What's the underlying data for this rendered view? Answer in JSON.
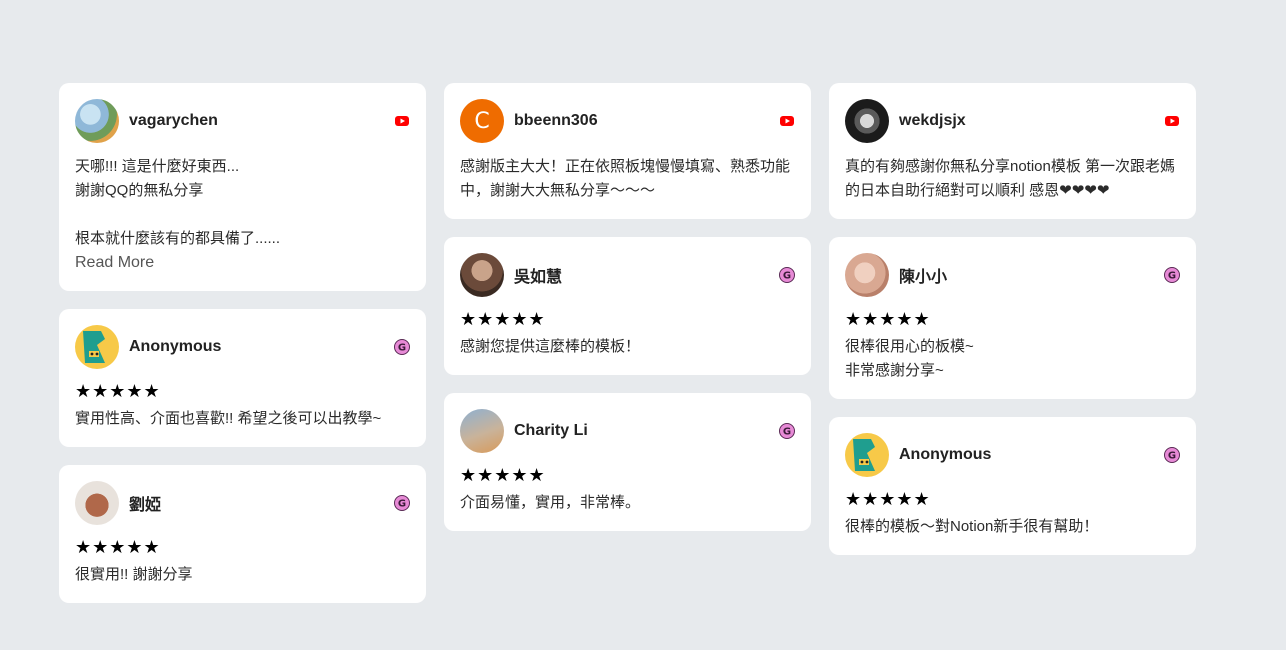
{
  "colors": {
    "background": "#e7eaed",
    "card": "#ffffff",
    "youtube_red": "#ff0000",
    "google_badge_pink": "#e78ad6"
  },
  "reviews": [
    {
      "name": "vagarychen",
      "source_icon": "youtube-icon",
      "stars": "",
      "text": "天哪!!! 這是什麼好東西...\n謝謝QQ的無私分享\n\n根本就什麼該有的都具備了......",
      "read_more": "Read More"
    },
    {
      "name": "Anonymous",
      "source_icon": "google-icon",
      "stars": "★★★★★",
      "rating": 5,
      "text": "實用性高、介面也喜歡!! 希望之後可以出教學~"
    },
    {
      "name": "劉婭",
      "source_icon": "google-icon",
      "stars": "★★★★★",
      "rating": 5,
      "text": "很實用!! 謝謝分享"
    },
    {
      "name": "bbeenn306",
      "avatar_initial": "C",
      "source_icon": "youtube-icon",
      "text": "感謝版主大大！正在依照板塊慢慢填寫、熟悉功能中，謝謝大大無私分享～～～"
    },
    {
      "name": "吳如慧",
      "source_icon": "google-icon",
      "stars": "★★★★★",
      "rating": 5,
      "text": "感謝您提供這麼棒的模板！"
    },
    {
      "name": "Charity Li",
      "source_icon": "google-icon",
      "stars": "★★★★★",
      "rating": 5,
      "text": "介面易懂，實用，非常棒。"
    },
    {
      "name": "wekdjsjx",
      "source_icon": "youtube-icon",
      "text": "真的有夠感謝你無私分享notion模板 第一次跟老媽的日本自助行絕對可以順利 感恩❤❤❤❤"
    },
    {
      "name": "陳小小",
      "source_icon": "google-icon",
      "stars": "★★★★★",
      "rating": 5,
      "text": "很棒很用心的板模~\n非常感謝分享~"
    },
    {
      "name": "Anonymous",
      "source_icon": "google-icon",
      "stars": "★★★★★",
      "rating": 5,
      "text": "很棒的模板～對Notion新手很有幫助！"
    }
  ]
}
